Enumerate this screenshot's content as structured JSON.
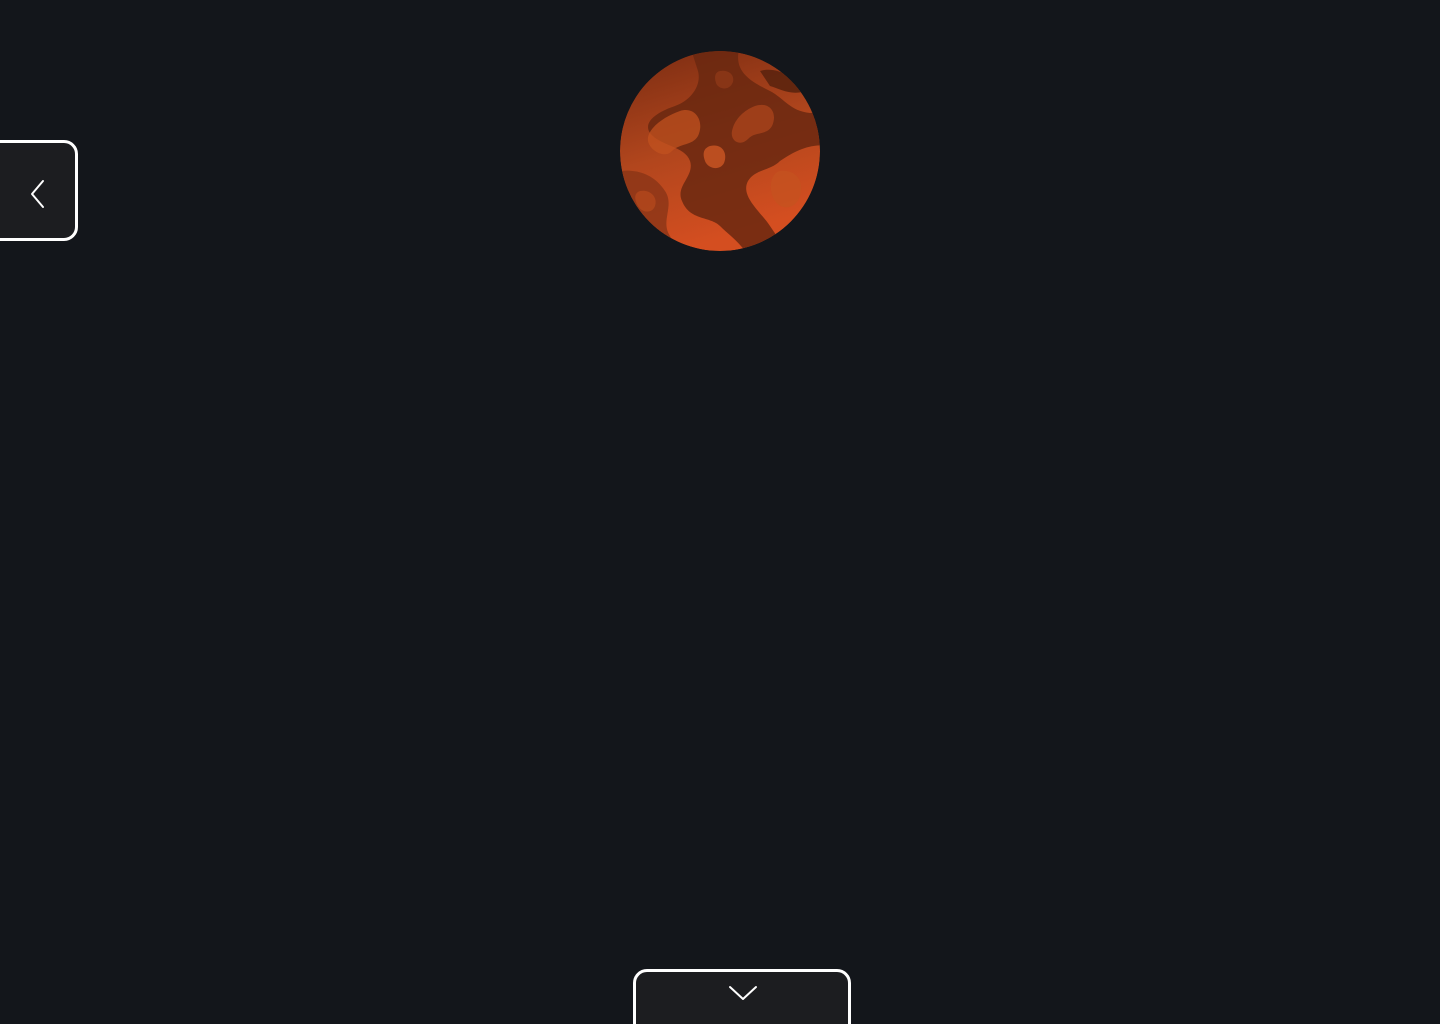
{
  "theme": {
    "background": "#13161b",
    "panel": "#1c1d20",
    "border": "#ffffff"
  },
  "planet": {
    "icon": "planet-icon",
    "colors": [
      "#6d2a12",
      "#a8421c",
      "#d04e20"
    ]
  },
  "side_panel_toggle": {
    "icon": "chevron-left-icon"
  },
  "bottom_panel_toggle": {
    "icon": "chevron-down-icon"
  }
}
